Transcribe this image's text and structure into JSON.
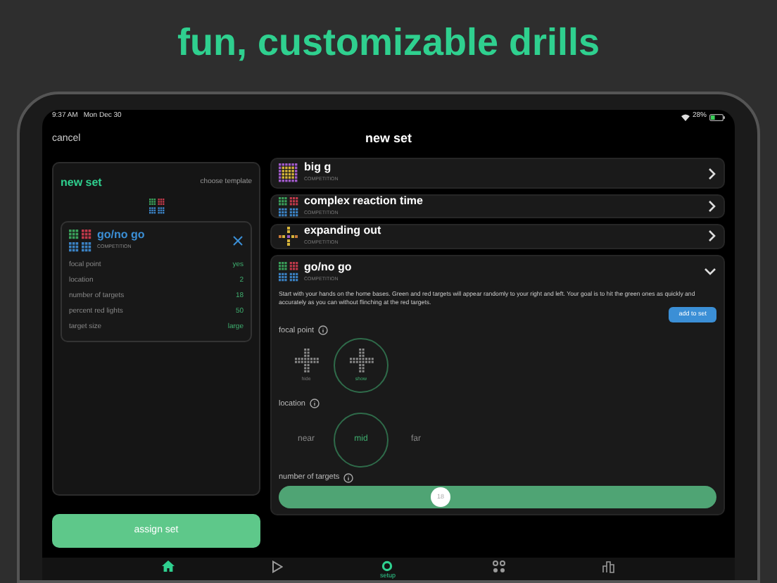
{
  "headline": "fun, customizable drills",
  "status_bar": {
    "time": "9:37 AM",
    "date": "Mon Dec 30",
    "battery": "28%"
  },
  "nav": {
    "cancel": "cancel",
    "title": "new set"
  },
  "set_panel": {
    "title": "new set",
    "template_link": "choose template",
    "drills": [
      {
        "name": "go/no go",
        "category": "COMPETITION",
        "settings": [
          {
            "label": "focal point",
            "value": "yes"
          },
          {
            "label": "location",
            "value": "2"
          },
          {
            "label": "number of targets",
            "value": "18"
          },
          {
            "label": "percent red lights",
            "value": "50"
          },
          {
            "label": "target size",
            "value": "large"
          }
        ]
      }
    ],
    "assign_button": "assign set"
  },
  "drill_list": [
    {
      "name": "big g",
      "category": "COMPETITION",
      "expanded": false
    },
    {
      "name": "complex reaction time",
      "category": "COMPETITION",
      "expanded": false
    },
    {
      "name": "expanding out",
      "category": "COMPETITION",
      "expanded": false
    },
    {
      "name": "go/no go",
      "category": "COMPETITION",
      "expanded": true,
      "description": "Start with your hands on the home bases. Green and red targets will appear randomly to your right and left. Your goal is to hit the green ones as quickly and accurately as you can without flinching at the red targets.",
      "add_button": "add to set",
      "options": [
        {
          "label": "focal point",
          "kind": "icons",
          "choices": [
            {
              "label": "hide",
              "selected": false
            },
            {
              "label": "show",
              "selected": true
            }
          ]
        },
        {
          "label": "location",
          "kind": "text",
          "choices": [
            {
              "label": "near",
              "selected": false
            },
            {
              "label": "mid",
              "selected": true
            },
            {
              "label": "far",
              "selected": false
            }
          ]
        },
        {
          "label": "number of targets",
          "kind": "slider",
          "level": 0.37,
          "reading": "18"
        }
      ]
    }
  ],
  "tab_bar": [
    {
      "selected": true
    },
    {
      "selected": false
    },
    {
      "label": "setup",
      "selected": true
    },
    {
      "selected": false
    },
    {
      "selected": false
    }
  ]
}
